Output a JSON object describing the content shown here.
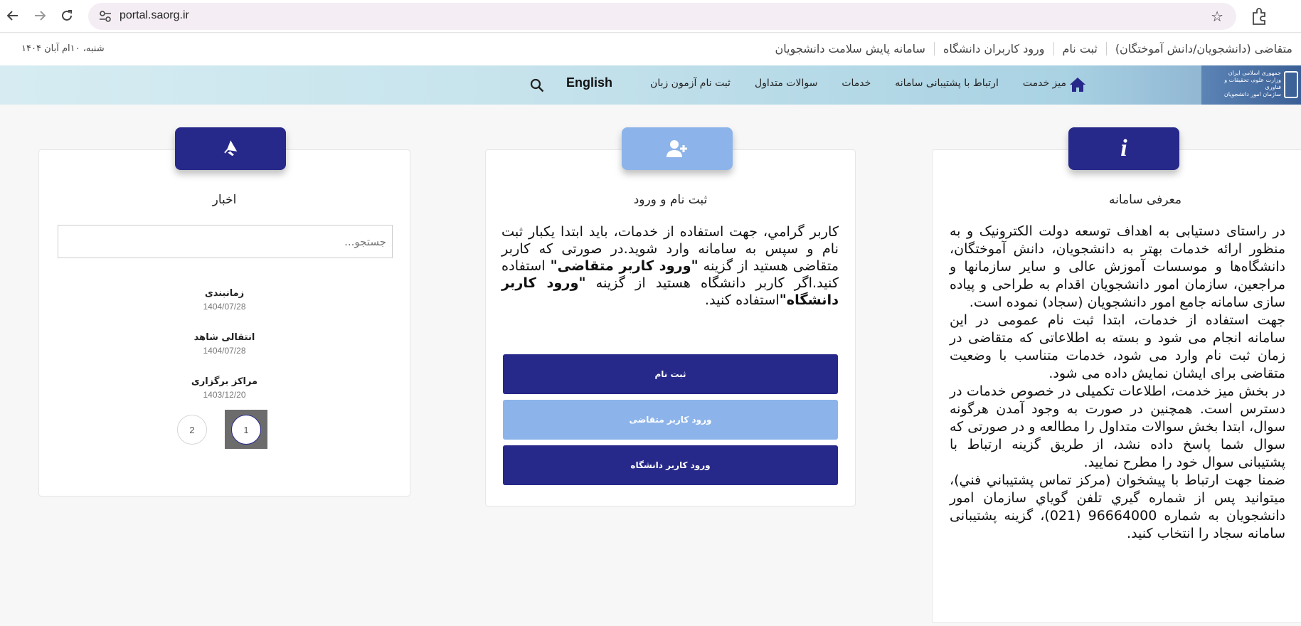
{
  "browser": {
    "url": "portal.saorg.ir",
    "icons": [
      "back-icon",
      "forward-icon",
      "reload-icon",
      "site-settings-icon",
      "bookmark-star-icon",
      "extensions-icon"
    ]
  },
  "topbar": {
    "date": "شنبه، ۱۰ام آبان ۱۴۰۴",
    "links": [
      "متقاضی (دانشجویان/دانش آموختگان)",
      "ثبت نام",
      "ورود کاربران دانشگاه",
      "سامانه پایش سلامت دانشجویان"
    ]
  },
  "logo": {
    "lines": [
      "جمهوری اسلامی ایران",
      "وزارت علوم، تحقیقات و فناوری",
      "سازمان امور دانشجویان"
    ]
  },
  "nav": {
    "items": [
      "میز خدمت",
      "ارتباط با پشتیبانی سامانه",
      "خدمات",
      "سوالات متداول",
      "ثبت نام آزمون زبان"
    ],
    "english": "English"
  },
  "info_card": {
    "title": "معرفی سامانه",
    "icon": "info-icon",
    "paragraphs": [
      "در راستای دستیابی به اهداف توسعه دولت الکترونیک و به منظور ارائه خدمات بهتر به دانشجویان، دانش آموختگان، دانشگاه‌ها و موسسات آموزش عالی و سایر سازمانها و مراجعین، سازمان امور دانشجویان اقدام به طراحی و پیاده سازی سامانه جامع امور دانشجویان (سجاد) نموده است.",
      "جهت استفاده از خدمات، ابتدا ثبت نام عمومی در این سامانه انجام می شود و بسته به اطلاعاتی که متقاضی در زمان ثبت نام وارد می شود، خدمات متناسب با وضعیت متقاضی برای ایشان نمایش داده می شود.",
      "در بخش میز خدمت، اطلاعات تکمیلی در خصوص خدمات در دسترس است. همچنین در صورت به وجود آمدن هرگونه سوال، ابتدا بخش سوالات متداول را مطالعه و در صورتی که سوال شما پاسخ داده نشد، از طریق گزینه ارتباط با پشتیبانی سوال خود را مطرح نمایید.",
      "ضمنا جهت ارتباط با پیشخوان (مرکز تماس پشتیباني فني)، میتوانید پس از شماره گيري تلفن گوياي سازمان امور دانشجويان به شماره 96664000 (021)، گزینه پشتیبانی سامانه سجاد را انتخاب کنید."
    ]
  },
  "register_card": {
    "title": "ثبت نام و ورود",
    "icon": "add-user-icon",
    "text_1": "کاربر گرامي، جهت استفاده از خدمات، باید ابتدا یکبار ثبت نام و سپس به سامانه وارد شوید.در صورتی که کاربر متقاضی هستید از گزینه ",
    "bold_1": "\"ورود کاربر متقاضی\"",
    "text_2": " استفاده کنید.اگر کاربر دانشگاه هستید از گزینه ",
    "bold_2": "\"ورود کاربر دانشگاه\"",
    "text_3": "استفاده کنید.",
    "buttons": {
      "register": "ثبت نام",
      "applicant_login": "ورود کاربر متقاضی",
      "university_login": "ورود کاربر دانشگاه"
    }
  },
  "news_card": {
    "title": "اخبار",
    "icon": "megaphone-icon",
    "search_placeholder": "جستجو...",
    "items": [
      {
        "title": "زمانبندی",
        "date": "1404/07/28"
      },
      {
        "title": "انتقالی شاهد",
        "date": "1404/07/28"
      },
      {
        "title": "مراکز برگزاری",
        "date": "1403/12/20"
      }
    ],
    "pages": [
      "1",
      "2"
    ],
    "current_page": "1"
  },
  "colors": {
    "primary": "#27298a",
    "light_button": "#8cb4ea",
    "nav_gradient_end": "#d6ecf2"
  }
}
